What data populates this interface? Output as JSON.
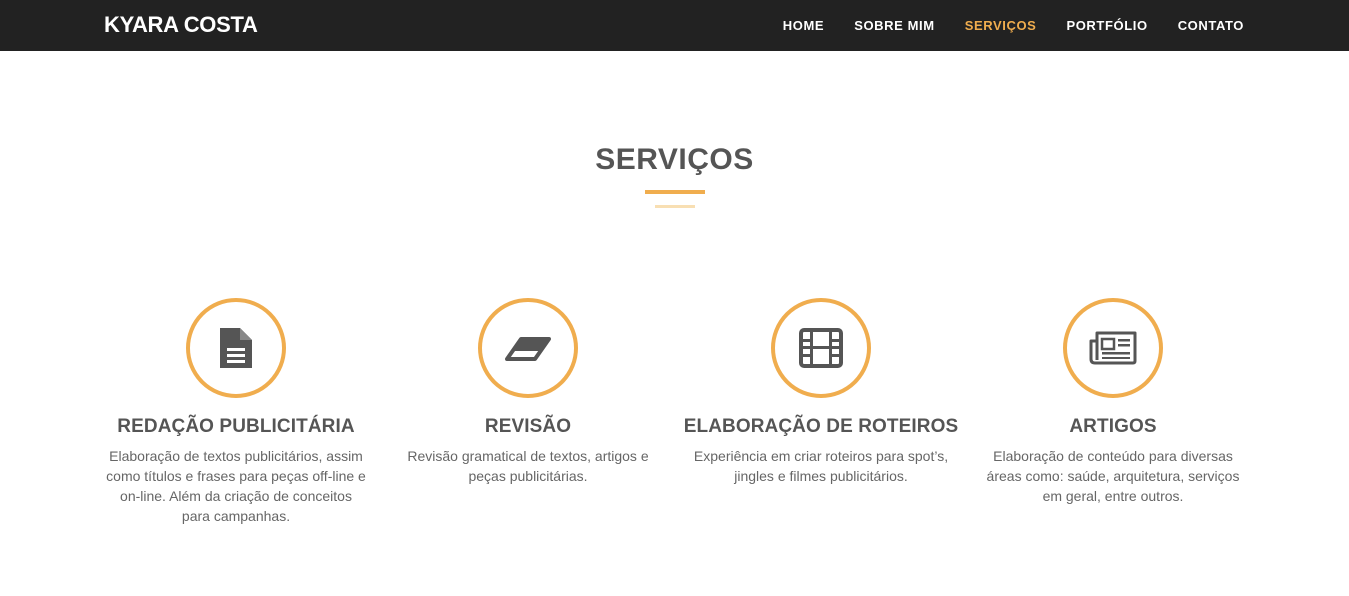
{
  "header": {
    "brand": "KYARA COSTA",
    "nav": [
      {
        "label": "HOME",
        "active": false
      },
      {
        "label": "SOBRE MIM",
        "active": false
      },
      {
        "label": "SERVIÇOS",
        "active": true
      },
      {
        "label": "PORTFÓLIO",
        "active": false
      },
      {
        "label": "CONTATO",
        "active": false
      }
    ]
  },
  "section": {
    "title": "SERVIÇOS"
  },
  "services": [
    {
      "icon": "document-icon",
      "title": "REDAÇÃO PUBLICITÁRIA",
      "description": "Elaboração de textos publicitários, assim como títulos e frases para peças off-line e on-line. Além da criação de conceitos para campanhas."
    },
    {
      "icon": "eraser-icon",
      "title": "REVISÃO",
      "description": "Revisão gramatical de textos, artigos e peças publicitárias."
    },
    {
      "icon": "film-icon",
      "title": "ELABORAÇÃO DE ROTEIROS",
      "description": "Experiência em criar roteiros para spot’s, jingles e filmes publicitários."
    },
    {
      "icon": "newspaper-icon",
      "title": "ARTIGOS",
      "description": "Elaboração de conteúdo para diversas áreas como: saúde, arquitetura, serviços em geral, entre outros."
    }
  ],
  "colors": {
    "navbar": "#222222",
    "accent": "#f0ad4e",
    "heading": "#555555",
    "text": "#666666"
  }
}
